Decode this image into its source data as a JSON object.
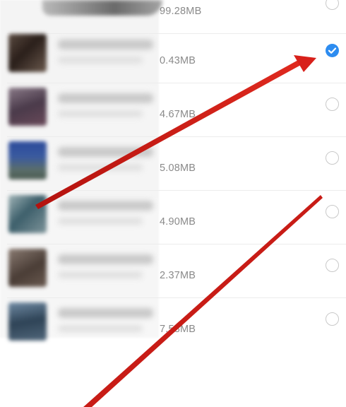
{
  "file_list": {
    "items": [
      {
        "size": "99.28MB",
        "selected": false,
        "thumb_colors": [
          "#cfcfcf",
          "#8f8f8f"
        ]
      },
      {
        "size": "0.43MB",
        "selected": true,
        "thumb_colors": [
          "#3b2f2a",
          "#6b5a4e"
        ]
      },
      {
        "size": "4.67MB",
        "selected": false,
        "thumb_colors": [
          "#4a3a4a",
          "#7c6a78"
        ]
      },
      {
        "size": "5.08MB",
        "selected": false,
        "thumb_colors": [
          "#2b4a8a",
          "#5b6e6a"
        ]
      },
      {
        "size": "4.90MB",
        "selected": false,
        "thumb_colors": [
          "#3d5f6b",
          "#8fa7ab"
        ]
      },
      {
        "size": "2.37MB",
        "selected": false,
        "thumb_colors": [
          "#4a3d36",
          "#8a7b72"
        ]
      },
      {
        "size": "7.58MB",
        "selected": false,
        "thumb_colors": [
          "#2e4356",
          "#6f8aa3"
        ]
      }
    ]
  },
  "colors": {
    "accent": "#2d8cf0",
    "annotation_red": "#d8201a",
    "size_text": "#8a8a8a"
  }
}
